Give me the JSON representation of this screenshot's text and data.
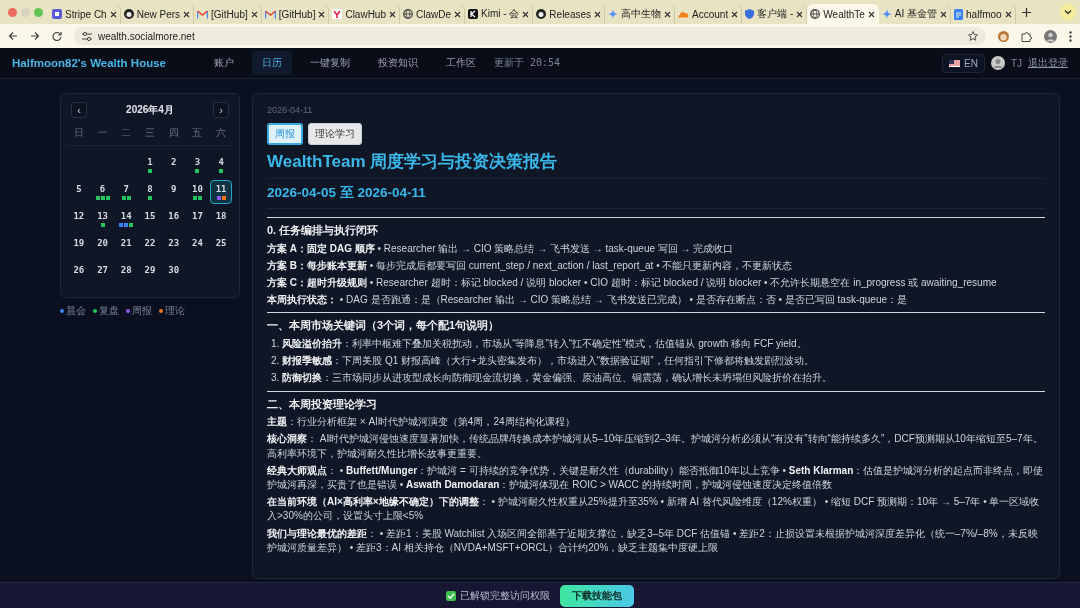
{
  "browser": {
    "tabs": [
      {
        "title": "Stripe Ch",
        "kind": "square",
        "selected": false
      },
      {
        "title": "New Pers",
        "kind": "github",
        "selected": false
      },
      {
        "title": "[GitHub]",
        "kind": "mail",
        "selected": false
      },
      {
        "title": "[GitHub]",
        "kind": "mail",
        "selected": false
      },
      {
        "title": "ClawHub",
        "kind": "y",
        "selected": false
      },
      {
        "title": "ClawDe",
        "kind": "globe",
        "selected": false
      },
      {
        "title": "Kimi - 会",
        "kind": "k",
        "selected": false
      },
      {
        "title": "Releases",
        "kind": "github",
        "selected": false
      },
      {
        "title": "高中生物",
        "kind": "spark",
        "selected": false
      },
      {
        "title": "Account",
        "kind": "cloud",
        "selected": false
      },
      {
        "title": "客户端 -",
        "kind": "shield",
        "selected": false
      },
      {
        "title": "WealthTe",
        "kind": "globe",
        "selected": true
      },
      {
        "title": "AI 基金管",
        "kind": "spark",
        "selected": false
      },
      {
        "title": "halfmoo",
        "kind": "doc",
        "selected": false
      }
    ],
    "url": "wealth.socialmore.net"
  },
  "header": {
    "brand": "Halfmoon82's Wealth House",
    "nav": [
      {
        "label": "账户",
        "selected": false
      },
      {
        "label": "日历",
        "selected": true
      },
      {
        "label": "一键复制",
        "selected": false
      },
      {
        "label": "投资知识",
        "selected": false
      },
      {
        "label": "工作区",
        "selected": false
      }
    ],
    "updated": "更新于 20:54",
    "language": "EN",
    "user": "TJ",
    "logout": "退出登录"
  },
  "calendar": {
    "title": "2026年4月",
    "prev": "‹",
    "next": "›",
    "weekdays": [
      "日",
      "一",
      "二",
      "三",
      "四",
      "五",
      "六"
    ],
    "weeks": [
      [
        {
          "day": "1",
          "selected": false,
          "dots": [
            {
              "color": "#22c55e"
            }
          ]
        },
        {
          "day": "2",
          "selected": false
        },
        {
          "day": "3",
          "selected": false,
          "dots": [
            {
              "color": "#22c55e"
            }
          ]
        },
        {
          "day": "4",
          "selected": false,
          "dots": [
            {
              "color": "#22c55e"
            }
          ]
        }
      ],
      [
        {
          "day": "5",
          "selected": false
        },
        {
          "day": "6",
          "selected": false,
          "dots": [
            {
              "color": "#22c55e"
            },
            {
              "color": "#22c55e"
            },
            {
              "color": "#22c55e"
            }
          ]
        },
        {
          "day": "7",
          "selected": false,
          "dots": [
            {
              "color": "#22c55e"
            },
            {
              "color": "#22c55e"
            }
          ]
        },
        {
          "day": "8",
          "selected": false,
          "dots": [
            {
              "color": "#22c55e"
            }
          ]
        },
        {
          "day": "9",
          "selected": false
        },
        {
          "day": "10",
          "selected": false,
          "dots": [
            {
              "color": "#22c55e"
            },
            {
              "color": "#22c55e"
            }
          ]
        },
        {
          "day": "11",
          "selected": true,
          "dots": [
            {
              "color": "#8b5cf6"
            },
            {
              "color": "#f97316"
            }
          ]
        }
      ],
      [
        {
          "day": "12",
          "selected": false
        },
        {
          "day": "13",
          "selected": false,
          "dots": [
            {
              "color": "#22c55e"
            }
          ]
        },
        {
          "day": "14",
          "selected": false,
          "dots": [
            {
              "color": "#3b82f6"
            },
            {
              "color": "#3b82f6"
            },
            {
              "color": "#22c55e"
            }
          ]
        },
        {
          "day": "15",
          "selected": false
        },
        {
          "day": "16",
          "selected": false
        },
        {
          "day": "17",
          "selected": false
        },
        {
          "day": "18",
          "selected": false
        }
      ],
      [
        {
          "day": "19",
          "selected": false
        },
        {
          "day": "20",
          "selected": false
        },
        {
          "day": "21",
          "selected": false
        },
        {
          "day": "22",
          "selected": false
        },
        {
          "day": "23",
          "selected": false
        },
        {
          "day": "24",
          "selected": false
        },
        {
          "day": "25",
          "selected": false
        }
      ],
      [
        {
          "day": "26",
          "selected": false
        },
        {
          "day": "27",
          "selected": false
        },
        {
          "day": "28",
          "selected": false
        },
        {
          "day": "29",
          "selected": false
        },
        {
          "day": "30",
          "selected": false
        }
      ]
    ],
    "legend": [
      {
        "label": "晨会",
        "color": "#3b82f6"
      },
      {
        "label": "复盘",
        "color": "#22c55e"
      },
      {
        "label": "周报",
        "color": "#8b5cf6"
      },
      {
        "label": "理论",
        "color": "#f97316"
      }
    ]
  },
  "report": {
    "date": "2026-04-11",
    "tabs": [
      {
        "label": "周报",
        "selected": true
      },
      {
        "label": "理论学习",
        "selected": false
      }
    ],
    "title": "WealthTeam 周度学习与投资决策报告",
    "subtitle": "2026-04-05 至 2026-04-11",
    "sections": [
      {
        "heading": "0. 任务编排与执行闭环",
        "paragraphs": [
          "**方案 A：固定 DAG 顺序** • Researcher 输出 → CIO 策略总结 → 飞书发送 → task-queue 写回 → 完成收口",
          "**方案 B：每步账本更新** • 每步完成后都要写回 current_step / next_action / last_report_at • 不能只更新内容，不更新状态",
          "**方案 C：超时升级规则** • Researcher 超时：标记 blocked / 说明 blocker • CIO 超时：标记 blocked / 说明 blocker • 不允许长期悬空在 in_progress 或 awaiting_resume",
          "**本周执行状态：** • DAG 是否跑通：是（Researcher 输出 → CIO 策略总结 → 飞书发送已完成） • 是否存在断点：否 • 是否已写回 task-queue：是"
        ]
      },
      {
        "heading": "一、本周市场关键词（3个词，每个配1句说明）",
        "items": [
          "1. **风险溢价抬升**：利率中枢难下叠加关税扰动，市场从“等降息”转入“扛不确定性”模式，估值锚从 growth 移向 FCF yield。",
          "2. **财报季敏感**：下周美股 Q1 财报高峰（大行+龙头密集发布），市场进入“数据验证期”，任何指引下修都将触发剧烈波动。",
          "3. **防御切换**：三市场同步从进攻型成长向防御现金流切换，黄金偏强、原油高位、铜震荡，确认增长未坍塌但风险折价在抬升。"
        ]
      },
      {
        "heading": "二、本周投资理论学习",
        "paragraphs": [
          "**主题**：行业分析框架 × AI时代护城河演变（第4周，24周结构化课程）",
          "**核心洞察**： AI时代护城河侵蚀速度显著加快，传统品牌/转换成本护城河从5–10年压缩到2–3年。护城河分析必须从“有没有”转向“能持续多久”，DCF预测期从10年缩短至5–7年。高利率环境下，护城河耐久性比增长故事更重要。",
          "**经典大师观点**： • **Buffett/Munger**：护城河 = 可持续的竞争优势，关键是耐久性（durability）能否抵御10年以上竞争 • **Seth Klarman**：估值是护城河分析的起点而非终点，即使护城河再深，买贵了也是错误 • **Aswath Damodaran**：护城河体现在 ROIC > WACC 的持续时间，护城河侵蚀速度决定终值倍数",
          "**在当前环境（AI×高利率×地缘不确定）下的调整**： • 护城河耐久性权重从25%提升至35% • 新增 AI 替代风险维度（12%权重） • 缩短 DCF 预测期：10年 → 5–7年 • 单一区域收入>30%的公司，设置头寸上限<5%",
          "**我们与理论最优的差距**： • 差距1：美股 Watchlist 入场区间全部基于近期支撑位，缺乏3–5年 DCF 估值锚 • 差距2：止损设置未根据护城河深度差异化（统一–7%/–8%，未反映护城河质量差异） • 差距3：AI 相关持仓（NVDA+MSFT+ORCL）合计约20%，缺乏主题集中度硬上限"
        ]
      }
    ]
  },
  "bottom_bar": {
    "access": {
      "label": "已解锁完整访问权限",
      "checked": true
    },
    "button": "下载技能包"
  }
}
